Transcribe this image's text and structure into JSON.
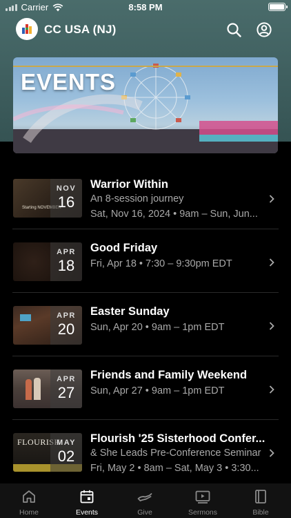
{
  "status_bar": {
    "carrier": "Carrier",
    "time": "8:58 PM"
  },
  "header": {
    "title": "CC USA (NJ)",
    "search_icon": "search-icon",
    "account_icon": "account-icon"
  },
  "banner": {
    "title": "EVENTS"
  },
  "events": [
    {
      "title": "Warrior Within",
      "subtitle": "An 8-session journey",
      "when": "Sat, Nov 16, 2024 • 9am – Sun, Jun...",
      "month": "NOV",
      "day": "16",
      "thumb_text": "Starting NOVEMBER"
    },
    {
      "title": "Good Friday",
      "subtitle": "",
      "when": "Fri, Apr 18 • 7:30 – 9:30pm EDT",
      "month": "APR",
      "day": "18"
    },
    {
      "title": "Easter Sunday",
      "subtitle": "",
      "when": "Sun, Apr 20 • 9am – 1pm EDT",
      "month": "APR",
      "day": "20"
    },
    {
      "title": "Friends and Family Weekend",
      "subtitle": "",
      "when": "Sun, Apr 27 • 9am – 1pm EDT",
      "month": "APR",
      "day": "27"
    },
    {
      "title": "Flourish '25 Sisterhood Confer...",
      "subtitle": "& She Leads Pre-Conference Seminar",
      "when": "Fri, May 2 • 8am – Sat, May 3 • 3:30...",
      "month": "MAY",
      "day": "02",
      "thumb_text": "FLOURISH"
    }
  ],
  "tabs": [
    {
      "label": "Home",
      "icon": "home-icon"
    },
    {
      "label": "Events",
      "icon": "calendar-icon",
      "active": true
    },
    {
      "label": "Give",
      "icon": "give-icon"
    },
    {
      "label": "Sermons",
      "icon": "video-icon"
    },
    {
      "label": "Bible",
      "icon": "book-icon"
    }
  ],
  "colors": {
    "header_bg": "#46696a",
    "background": "#000000",
    "tabbar_bg": "#121212",
    "muted_text": "#a9a9a9",
    "accent_gold": "#c9a84a"
  }
}
